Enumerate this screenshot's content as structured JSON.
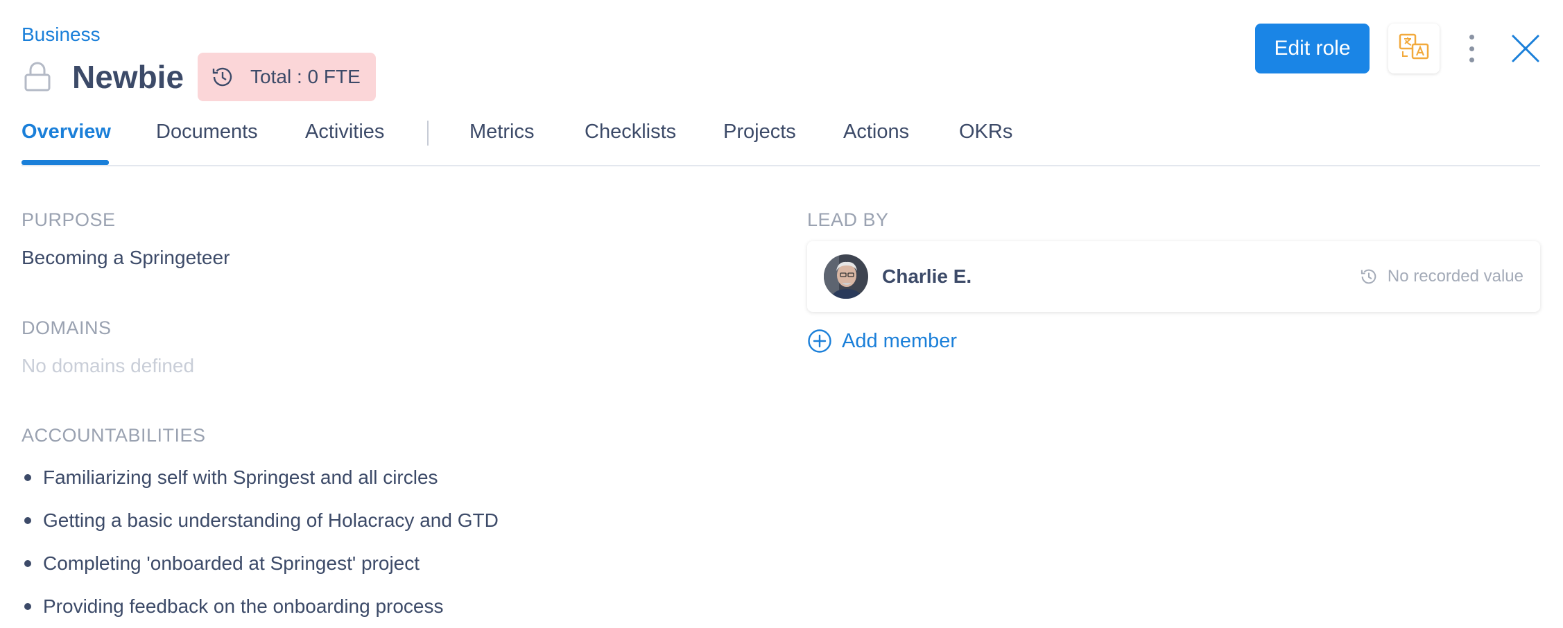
{
  "header": {
    "breadcrumb": "Business",
    "title": "Newbie",
    "fte_badge": "Total : 0 FTE",
    "edit_button": "Edit role",
    "icons": {
      "lock": "lock-icon",
      "history": "history-icon",
      "translate": "translate-icon",
      "more": "more-vertical-icon",
      "close": "close-icon"
    }
  },
  "tabs": [
    {
      "label": "Overview",
      "active": true
    },
    {
      "label": "Documents"
    },
    {
      "label": "Activities"
    },
    {
      "label": "Metrics"
    },
    {
      "label": "Checklists"
    },
    {
      "label": "Projects"
    },
    {
      "label": "Actions"
    },
    {
      "label": "OKRs"
    }
  ],
  "overview": {
    "purpose_label": "PURPOSE",
    "purpose_text": "Becoming a Springeteer",
    "domains_label": "DOMAINS",
    "domains_empty": "No domains defined",
    "accountabilities_label": "ACCOUNTABILITIES",
    "accountabilities": [
      "Familiarizing self with Springest and all circles",
      "Getting a basic understanding of Holacracy and GTD",
      "Completing 'onboarded at Springest' project",
      "Providing feedback on the onboarding process"
    ]
  },
  "lead": {
    "label": "LEAD BY",
    "name": "Charlie E.",
    "value_text": "No recorded value",
    "add_member": "Add member"
  },
  "colors": {
    "accent": "#1a85e6",
    "badge_bg": "#fbd6d8",
    "text": "#3c4a68",
    "muted": "#9aa2b1",
    "translate_icon": "#f2a93b"
  }
}
